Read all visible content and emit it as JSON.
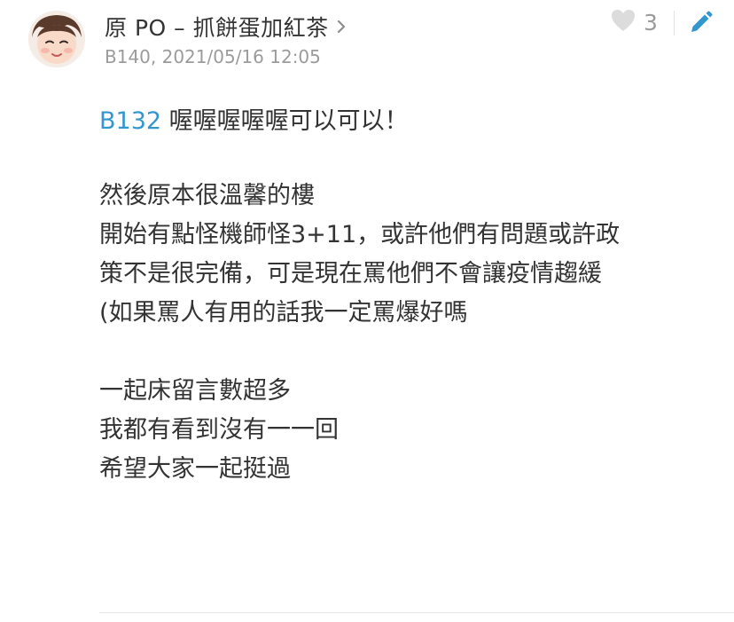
{
  "post": {
    "author": "原 PO – 抓餅蛋加紅茶",
    "floor": "B140",
    "timestamp": "2021/05/16 12:05",
    "meta_line": "B140, 2021/05/16 12:05",
    "like_count": "3",
    "reply_ref": "B132",
    "first_line": " 喔喔喔喔喔可以可以！",
    "paragraph2": [
      "然後原本很溫馨的樓",
      "開始有點怪機師怪3+11，或許他們有問題或許政",
      "策不是很完備，可是現在罵他們不會讓疫情趨緩",
      "(如果罵人有用的話我一定罵爆好嗎"
    ],
    "paragraph3": [
      "一起床留言數超多",
      "我都有看到沒有一一回",
      "希望大家一起挺過"
    ]
  },
  "icons": {
    "avatar": "avatar-photo",
    "chevron": "chevron-right-icon",
    "heart": "heart-icon",
    "edit": "pencil-icon"
  },
  "colors": {
    "link": "#3397cf",
    "heart": "#dcdcdc",
    "edit": "#3397cf",
    "meta": "#9b9b9b",
    "text": "#333333"
  }
}
